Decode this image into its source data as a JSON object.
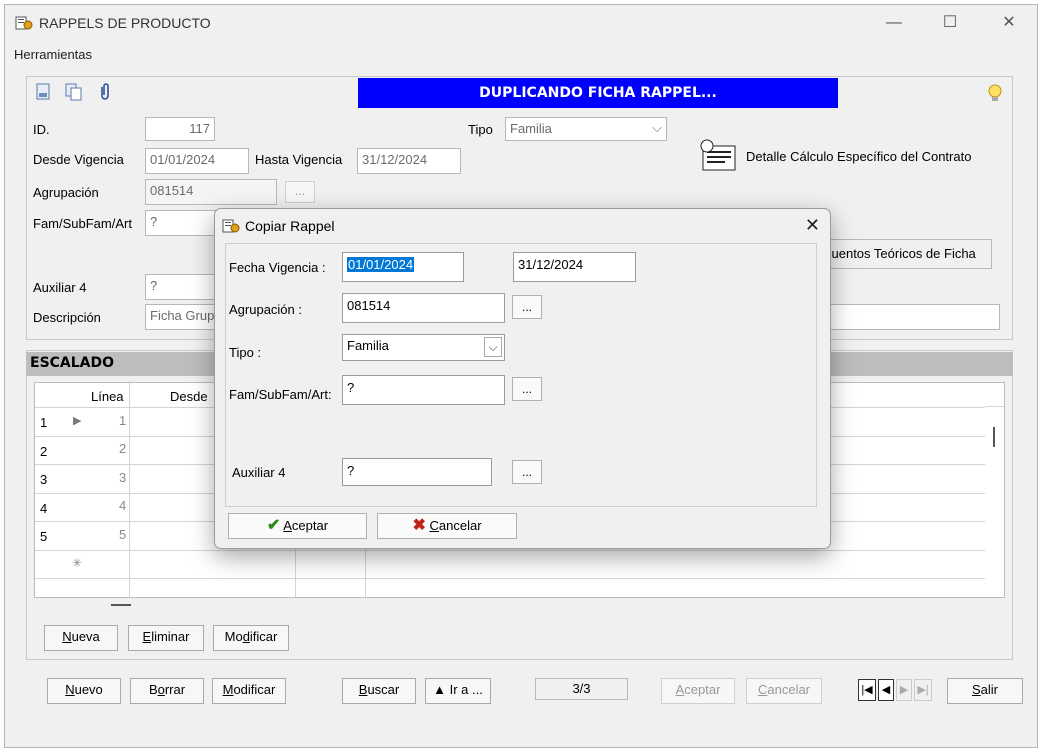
{
  "window": {
    "title": "RAPPELS DE PRODUCTO"
  },
  "menu": {
    "tools": "Herramientas"
  },
  "banner": "DUPLICANDO FICHA RAPPEL...",
  "form": {
    "id_label": "ID.",
    "id_value": "117",
    "tipo_label": "Tipo",
    "tipo_value": "Familia",
    "desde_label": "Desde Vigencia",
    "desde_value": "01/01/2024",
    "hasta_label": "Hasta Vigencia",
    "hasta_value": "31/12/2024",
    "agrup_label": "Agrupación",
    "agrup_value": "081514",
    "fam_label": "Fam/SubFam/Art",
    "fam_value": "?",
    "aux_label": "Auxiliar 4",
    "aux_value": "?",
    "desc_label": "Descripción",
    "desc_value": "Ficha Grup",
    "detalle_label": "Detalle Cálculo Específico del Contrato",
    "descuentos_label": "cuentos Teóricos de Ficha",
    "browse": "..."
  },
  "escalado": {
    "title": "ESCALADO",
    "col_linea": "Línea",
    "col_desde": "Desde",
    "rows": [
      {
        "n": "1",
        "linea": "1"
      },
      {
        "n": "2",
        "linea": "2"
      },
      {
        "n": "3",
        "linea": "3"
      },
      {
        "n": "4",
        "linea": "4"
      },
      {
        "n": "5",
        "linea": "5"
      }
    ],
    "buttons": {
      "nueva": "Nueva",
      "eliminar": "Eliminar",
      "modificar": "Modificar"
    }
  },
  "footer": {
    "nuevo": "Nuevo",
    "borrar": "Borrar",
    "modificar": "Modificar",
    "buscar": "Buscar",
    "ira": "▲ Ir a ...",
    "counter": "3/3",
    "aceptar": "Aceptar",
    "cancelar": "Cancelar",
    "salir": "Salir"
  },
  "dialog": {
    "title": "Copiar Rappel",
    "fecha_label": "Fecha Vigencia :",
    "fecha_desde": "01/01/2024",
    "fecha_hasta": "31/12/2024",
    "agrup_label": "Agrupación :",
    "agrup_value": "081514",
    "tipo_label": "Tipo :",
    "tipo_value": "Familia",
    "fam_label": "Fam/SubFam/Art:",
    "fam_value": "?",
    "aux_label": "Auxiliar 4",
    "aux_value": "?",
    "browse": "...",
    "aceptar": "Aceptar",
    "cancelar": "Cancelar"
  },
  "colors": {
    "banner": "#0000ff",
    "selection": "#0078d7"
  },
  "icons": [
    "app-icon",
    "minimize-icon",
    "maximize-icon",
    "close-icon",
    "new-doc-icon",
    "copy-icon",
    "attachment-icon",
    "lightbulb-icon",
    "contract-detail-icon",
    "row-pointer-icon",
    "new-row-icon",
    "accept-check-icon",
    "cancel-x-icon",
    "first-record-icon",
    "prev-record-icon",
    "next-record-icon",
    "last-record-icon",
    "dropdown-chevron-icon"
  ]
}
